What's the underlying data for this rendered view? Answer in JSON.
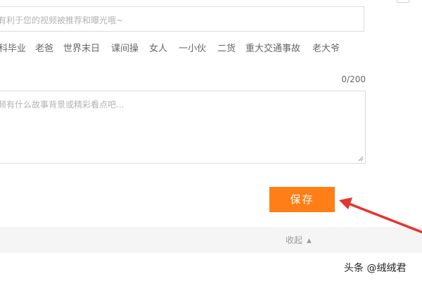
{
  "tags_input": {
    "placeholder": "有利于您的视频被推荐和曝光哦~"
  },
  "suggested_tags": [
    "科毕业",
    "老爸",
    "世界末日",
    "课间操",
    "女人",
    "一小伙",
    "二货",
    "重大交通事故",
    "老大爷"
  ],
  "description": {
    "counter": "0/200",
    "placeholder": "频有什么故事背景或精彩看点吧..."
  },
  "save_button": {
    "label": "保存"
  },
  "collapse": {
    "label": "收起",
    "icon": "caret-up-icon"
  },
  "annotation": {
    "color": "#e8322e"
  },
  "watermark": {
    "text": "头条 @绒绒君"
  },
  "colors": {
    "accent": "#ff7f16",
    "border": "#dcdcdc",
    "bar_bg": "#f5f5f5"
  }
}
